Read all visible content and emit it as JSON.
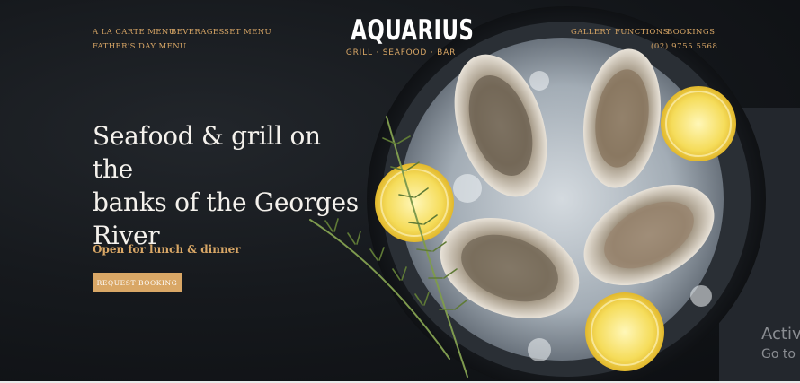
{
  "nav_left": {
    "row1": [
      "A LA CARTE MENU",
      "BEVERAGES",
      "SET MENU"
    ],
    "row2": [
      "FATHER'S DAY MENU"
    ]
  },
  "nav_right": {
    "items": [
      "GALLERY",
      "FUNCTIONS",
      "BOOKINGS"
    ],
    "phone": "(02) 9755 5568"
  },
  "logo": {
    "name": "AQUARIUS",
    "tagline": "GRILL · SEAFOOD · BAR"
  },
  "hero": {
    "headline_lines": [
      "Seafood & grill on the",
      "banks of the Georges",
      "River"
    ],
    "subline": "Open for lunch & dinner",
    "cta_label": "REQUEST BOOKING"
  },
  "watermark": {
    "line1": "Activ",
    "line2": "Go to"
  },
  "colors": {
    "background": "#0d0f12",
    "accent_gold": "#d9a766",
    "headline": "#f4f1ec"
  }
}
